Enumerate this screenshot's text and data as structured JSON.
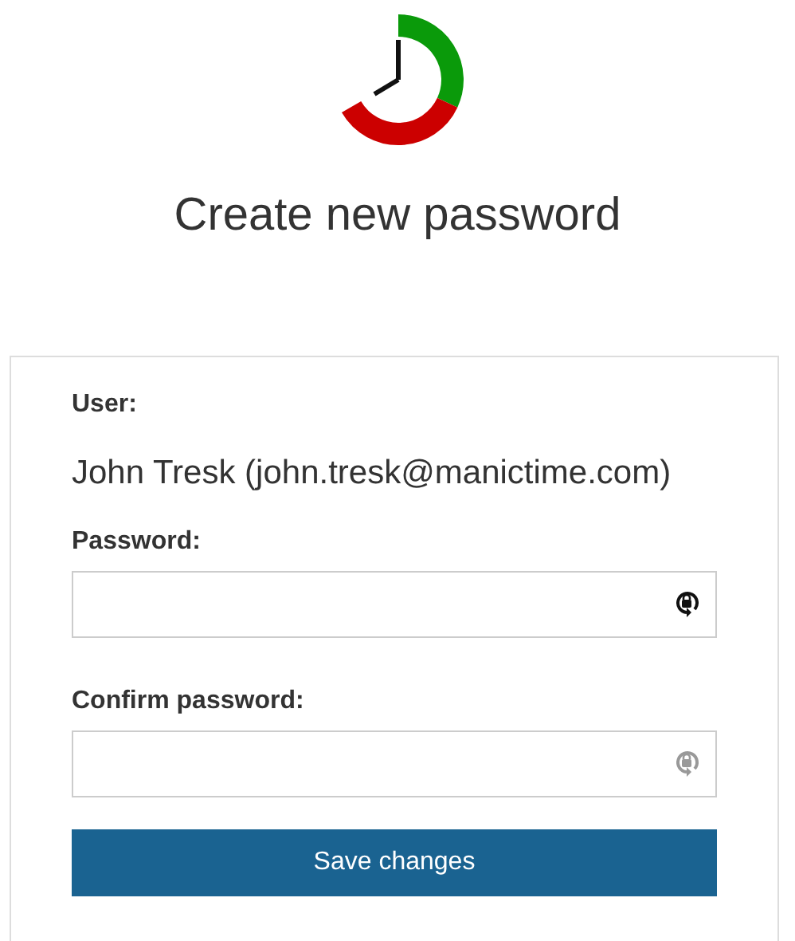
{
  "title": "Create new password",
  "user": {
    "label": "User:",
    "value": "John Tresk (john.tresk@manictime.com)"
  },
  "fields": [
    {
      "label": "Password:",
      "focused": true
    },
    {
      "label": "Confirm password:",
      "focused": false
    }
  ],
  "button": "Save changes"
}
